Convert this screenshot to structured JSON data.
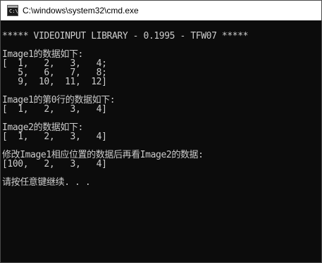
{
  "window": {
    "title": "C:\\windows\\system32\\cmd.exe",
    "icon": "cmd-console-icon",
    "icon_prompt": "C:\\"
  },
  "colors": {
    "console_background": "#0c0c0c",
    "console_text": "#cccccc",
    "titlebar_background": "#ffffff"
  },
  "console": {
    "lines": [
      "***** VIDEOINPUT LIBRARY - 0.1995 - TFW07 *****",
      "",
      "Image1的数据如下:",
      "[  1,   2,   3,   4;",
      "   5,   6,   7,   8;",
      "   9,  10,  11,  12]",
      "",
      "Image1的第0行的数据如下:",
      "[  1,   2,   3,   4]",
      "",
      "Image2的数据如下:",
      "[  1,   2,   3,   4]",
      "",
      "修改Image1相应位置的数据后再看Image2的数据:",
      "[100,   2,   3,   4]",
      "",
      "请按任意键继续. . ."
    ]
  }
}
